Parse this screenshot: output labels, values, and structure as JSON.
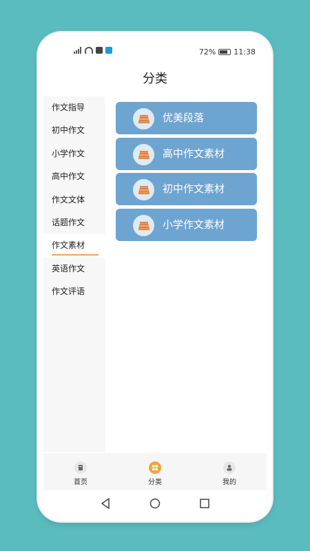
{
  "status_bar": {
    "battery": "72%",
    "time": "11:38"
  },
  "header": {
    "title": "分类"
  },
  "sidebar": {
    "items": [
      {
        "label": "作文指导"
      },
      {
        "label": "初中作文"
      },
      {
        "label": "小学作文"
      },
      {
        "label": "高中作文"
      },
      {
        "label": "作文文体"
      },
      {
        "label": "话题作文"
      },
      {
        "label": "作文素材",
        "active": true
      },
      {
        "label": "英语作文"
      },
      {
        "label": "作文评语"
      }
    ]
  },
  "categories": [
    {
      "label": "优美段落",
      "icon": "books-icon"
    },
    {
      "label": "高中作文素材",
      "icon": "books-icon"
    },
    {
      "label": "初中作文素材",
      "icon": "books-icon"
    },
    {
      "label": "小学作文素材",
      "icon": "books-icon"
    }
  ],
  "tabbar": {
    "tabs": [
      {
        "label": "首页",
        "icon": "home-icon"
      },
      {
        "label": "分类",
        "icon": "category-icon",
        "active": true
      },
      {
        "label": "我的",
        "icon": "profile-icon"
      }
    ]
  },
  "colors": {
    "background": "#5bbcbf",
    "card": "#6ea4d0",
    "active_accent": "#f0a060",
    "tab_active": "#f1a33c"
  }
}
